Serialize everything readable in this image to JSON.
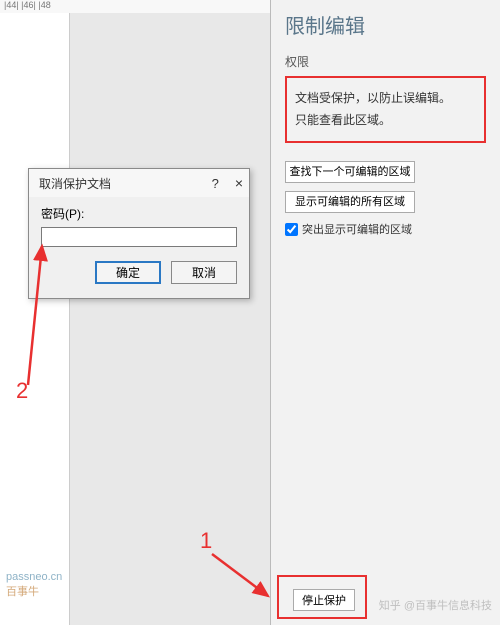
{
  "ruler": {
    "marks": "|44|  |46|  |48"
  },
  "sidebar": {
    "title": "限制编辑",
    "subtitle": "权限",
    "info_line1": "文档受保护，以防止误编辑。",
    "info_line2": "只能查看此区域。",
    "btn_find_next": "查找下一个可编辑的区域",
    "btn_show_all": "显示可编辑的所有区域",
    "checkbox_label": "突出显示可编辑的区域",
    "checkbox_checked": true,
    "stop_protect": "停止保护"
  },
  "dialog": {
    "title": "取消保护文档",
    "help": "?",
    "close": "×",
    "password_label": "密码(P):",
    "password_value": "",
    "ok": "确定",
    "cancel": "取消"
  },
  "annotations": {
    "label1": "1",
    "label2": "2"
  },
  "watermark": {
    "url": "passneo.cn",
    "brand": "百事牛"
  },
  "attribution": "知乎 @百事牛信息科技"
}
